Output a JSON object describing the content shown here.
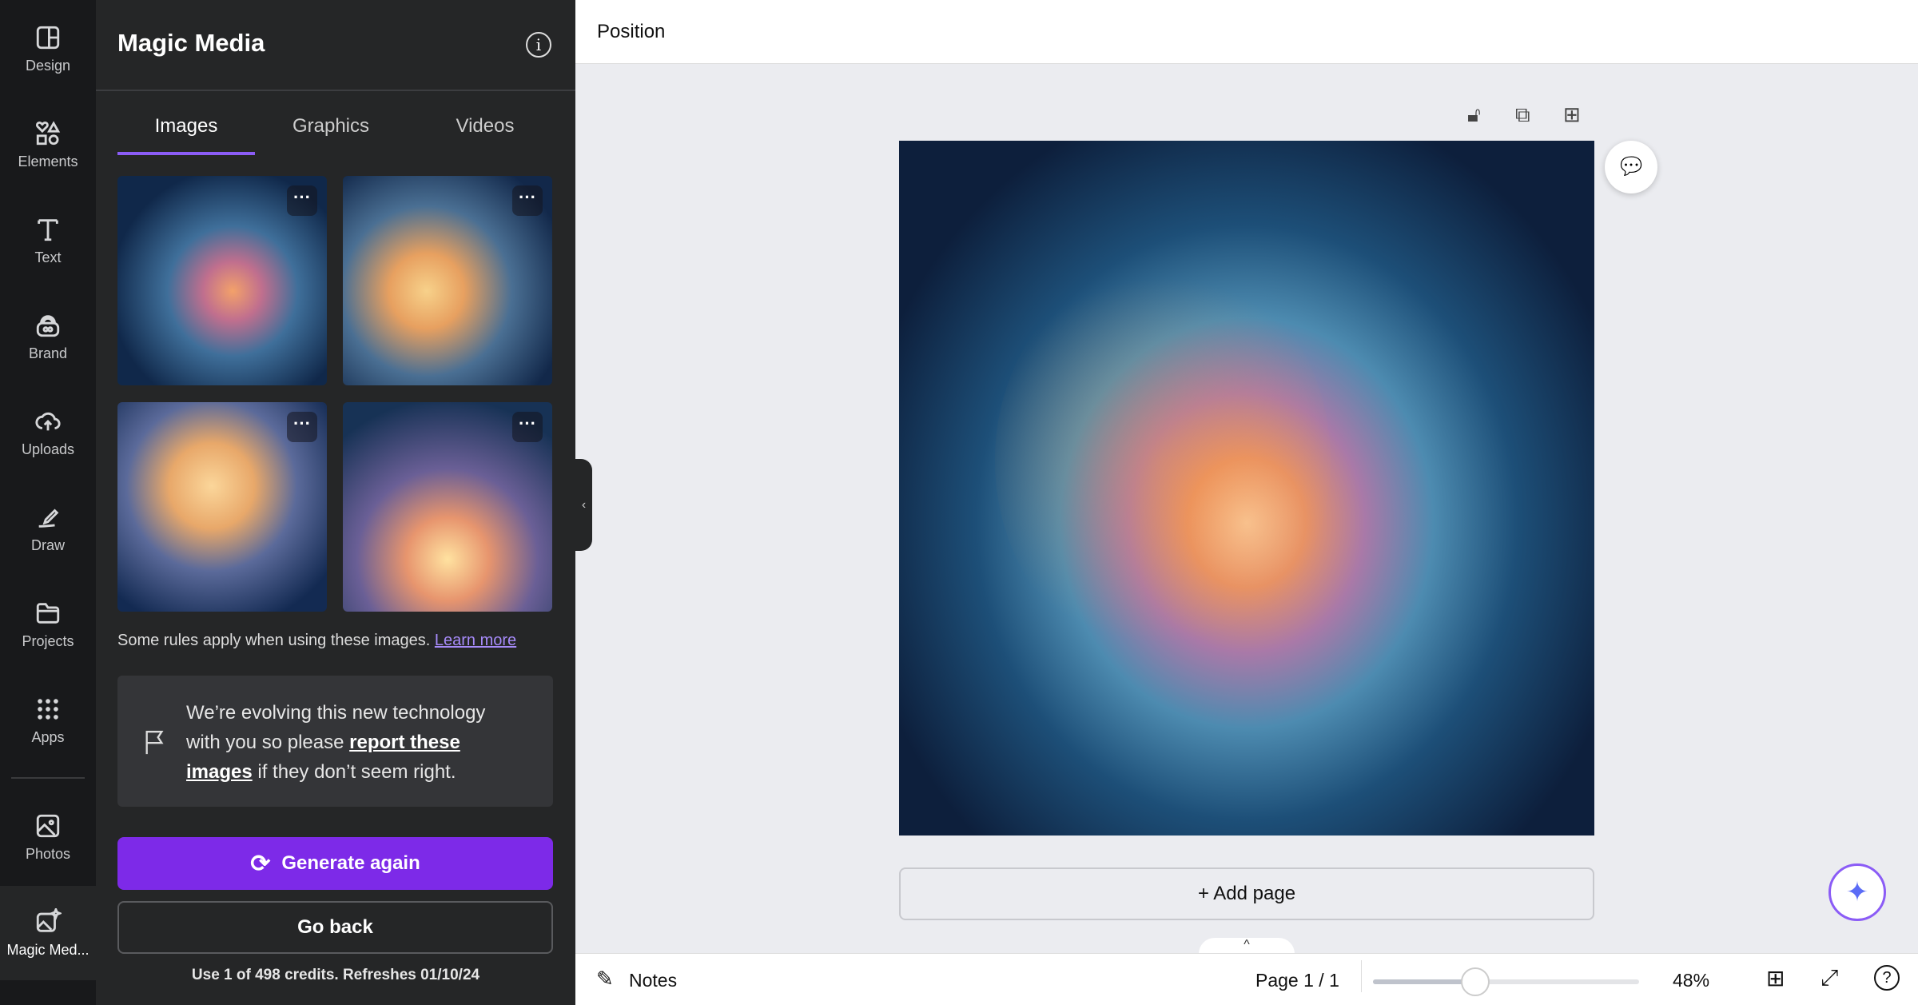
{
  "rail": {
    "items": [
      {
        "label": "Design",
        "icon": "design-icon"
      },
      {
        "label": "Elements",
        "icon": "elements-icon"
      },
      {
        "label": "Text",
        "icon": "text-icon"
      },
      {
        "label": "Brand",
        "icon": "brand-icon"
      },
      {
        "label": "Uploads",
        "icon": "cloud-upload-icon"
      },
      {
        "label": "Draw",
        "icon": "draw-icon"
      },
      {
        "label": "Projects",
        "icon": "folder-icon"
      },
      {
        "label": "Apps",
        "icon": "apps-grid-icon"
      },
      {
        "label": "Photos",
        "icon": "photo-icon"
      },
      {
        "label": "Magic Med...",
        "icon": "magic-media-icon",
        "active": true
      }
    ]
  },
  "panel": {
    "title": "Magic Media",
    "tabs": [
      {
        "label": "Images",
        "active": true
      },
      {
        "label": "Graphics"
      },
      {
        "label": "Videos"
      }
    ],
    "rules_text": "Some rules apply when using these images.",
    "learn_more": "Learn more",
    "feedback": {
      "pre": "We’re evolving this new technology with you so please ",
      "link": "report these images",
      "post": " if they don’t seem right."
    },
    "generate_again": "Generate again",
    "go_back": "Go back",
    "credits": "Use 1 of 498 credits. Refreshes 01/10/24"
  },
  "topbar": {
    "title": "Position"
  },
  "canvas": {
    "add_page": "+ Add page"
  },
  "bottombar": {
    "notes": "Notes",
    "page": "Page 1 / 1",
    "zoom": "48%",
    "zoom_slider_percent": 48
  },
  "colors": {
    "accent": "#8b5cf6",
    "rail_bg": "#18191b",
    "panel_bg": "#252627",
    "canvas_bg": "#ebecf0"
  }
}
